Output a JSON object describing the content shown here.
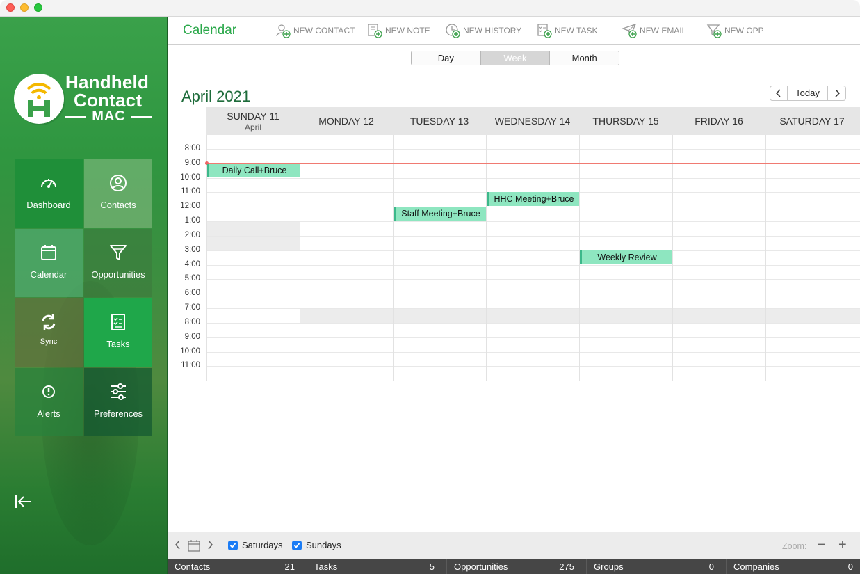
{
  "app": {
    "title": "Calendar",
    "logo": {
      "line1": "Handheld",
      "line2": "Contact",
      "line3": "MAC"
    }
  },
  "colors": {
    "brand_green": "#2aa84a",
    "event_fill": "#8ee6c0",
    "now_line": "#f07a72",
    "checkbox": "#1b7cf5"
  },
  "sidebar": {
    "tiles": [
      {
        "label": "Dashboard",
        "icon": "dashboard-gauge-icon"
      },
      {
        "label": "Contacts",
        "icon": "contacts-person-icon"
      },
      {
        "label": "Calendar",
        "icon": "calendar-icon"
      },
      {
        "label": "Opportunities",
        "icon": "funnel-icon"
      },
      {
        "label": "Sync",
        "icon": "sync-icon"
      },
      {
        "label": "Tasks",
        "icon": "tasks-checklist-icon"
      },
      {
        "label": "Alerts",
        "icon": "alert-icon"
      },
      {
        "label": "Preferences",
        "icon": "sliders-icon"
      }
    ]
  },
  "toolbar": {
    "new_contact": "NEW CONTACT",
    "new_note": "NEW NOTE",
    "new_history": "NEW HISTORY",
    "new_task": "NEW TASK",
    "new_email": "NEW EMAIL",
    "new_opp": "NEW OPP"
  },
  "view_switch": {
    "day": "Day",
    "week": "Week",
    "month": "Month",
    "selected": "Week"
  },
  "calendar": {
    "month_title": "April 2021",
    "today_label": "Today",
    "days": [
      {
        "name": "SUNDAY 11",
        "sub": "April"
      },
      {
        "name": "MONDAY 12"
      },
      {
        "name": "TUESDAY 13"
      },
      {
        "name": "WEDNESDAY 14"
      },
      {
        "name": "THURSDAY 15"
      },
      {
        "name": "FRIDAY 16"
      },
      {
        "name": "SATURDAY 17"
      }
    ],
    "times": [
      "8:00",
      "9:00",
      "10:00",
      "11:00",
      "12:00",
      "1:00",
      "2:00",
      "3:00",
      "4:00",
      "5:00",
      "6:00",
      "7:00",
      "8:00",
      "9:00",
      "10:00",
      "11:00"
    ],
    "events": [
      {
        "title": "Daily Call+Bruce",
        "day": "SUNDAY 11",
        "start": "9:00"
      },
      {
        "title": "HHC Meeting+Bruce",
        "day": "WEDNESDAY 14",
        "start": "11:00"
      },
      {
        "title": "Staff Meeting+Bruce",
        "day": "TUESDAY 13",
        "start": "12:00"
      },
      {
        "title": "Weekly Review",
        "day": "THURSDAY 15",
        "start": "3:00"
      }
    ]
  },
  "bottom": {
    "saturdays_label": "Saturdays",
    "saturdays_checked": true,
    "sundays_label": "Sundays",
    "sundays_checked": true,
    "zoom_label": "Zoom:",
    "zoom_out": "−",
    "zoom_in": "+"
  },
  "status": [
    {
      "label": "Contacts",
      "count": "21"
    },
    {
      "label": "Tasks",
      "count": "5"
    },
    {
      "label": "Opportunities",
      "count": "275"
    },
    {
      "label": "Groups",
      "count": "0"
    },
    {
      "label": "Companies",
      "count": "0"
    }
  ]
}
